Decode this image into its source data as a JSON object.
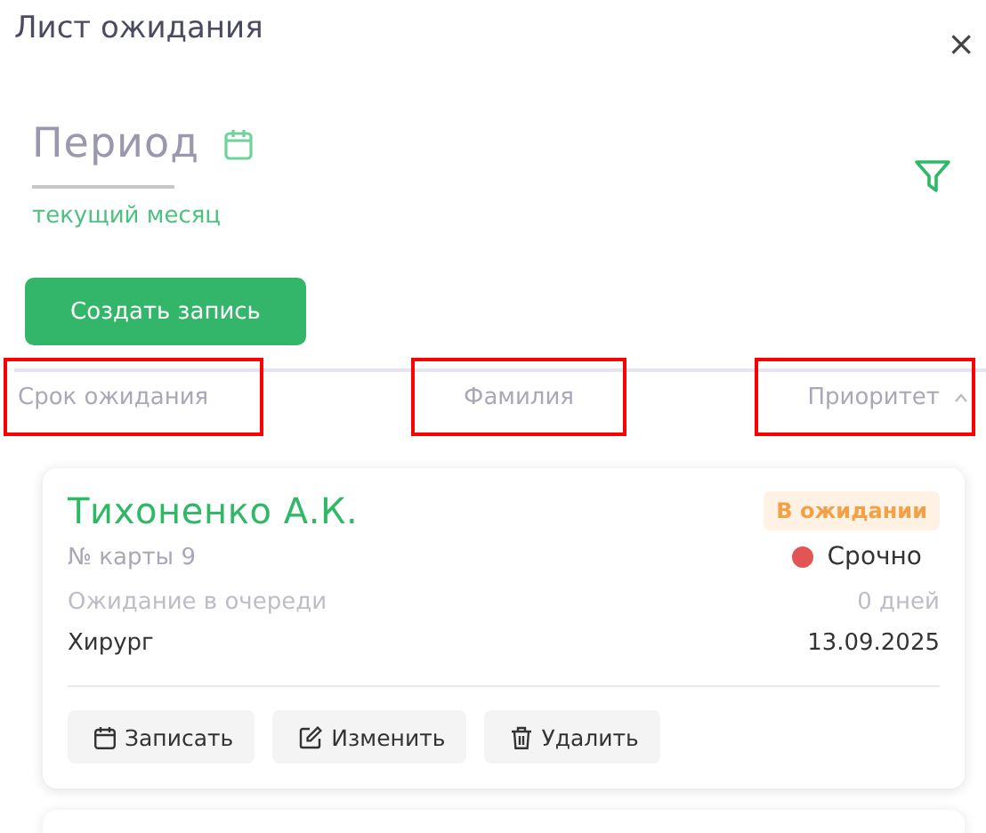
{
  "window": {
    "title": "Лист ожидания",
    "close": "×"
  },
  "period": {
    "label": "Период",
    "value": "текущий месяц"
  },
  "create_button": "Создать запись",
  "columns": [
    {
      "label": "Срок ожидания",
      "highlighted": true,
      "sorted": false
    },
    {
      "label": "Фамилия",
      "highlighted": true,
      "sorted": false
    },
    {
      "label": "Приоритет",
      "highlighted": true,
      "sorted": true
    }
  ],
  "cards": [
    {
      "name": "Тихоненко А.К.",
      "status": "В ожидании",
      "card_number": "№ карты 9",
      "priority": "Срочно",
      "color": "#e25555",
      "wait_label": "Ожидание в очереди",
      "wait_value": "0 дней",
      "specialty": "Хирург",
      "date": "13.09.2025",
      "actions": [
        {
          "kind": "calendar",
          "label": "Записать"
        },
        {
          "kind": "edit",
          "label": "Изменить"
        },
        {
          "kind": "delete",
          "label": "Удалить"
        }
      ]
    }
  ]
}
